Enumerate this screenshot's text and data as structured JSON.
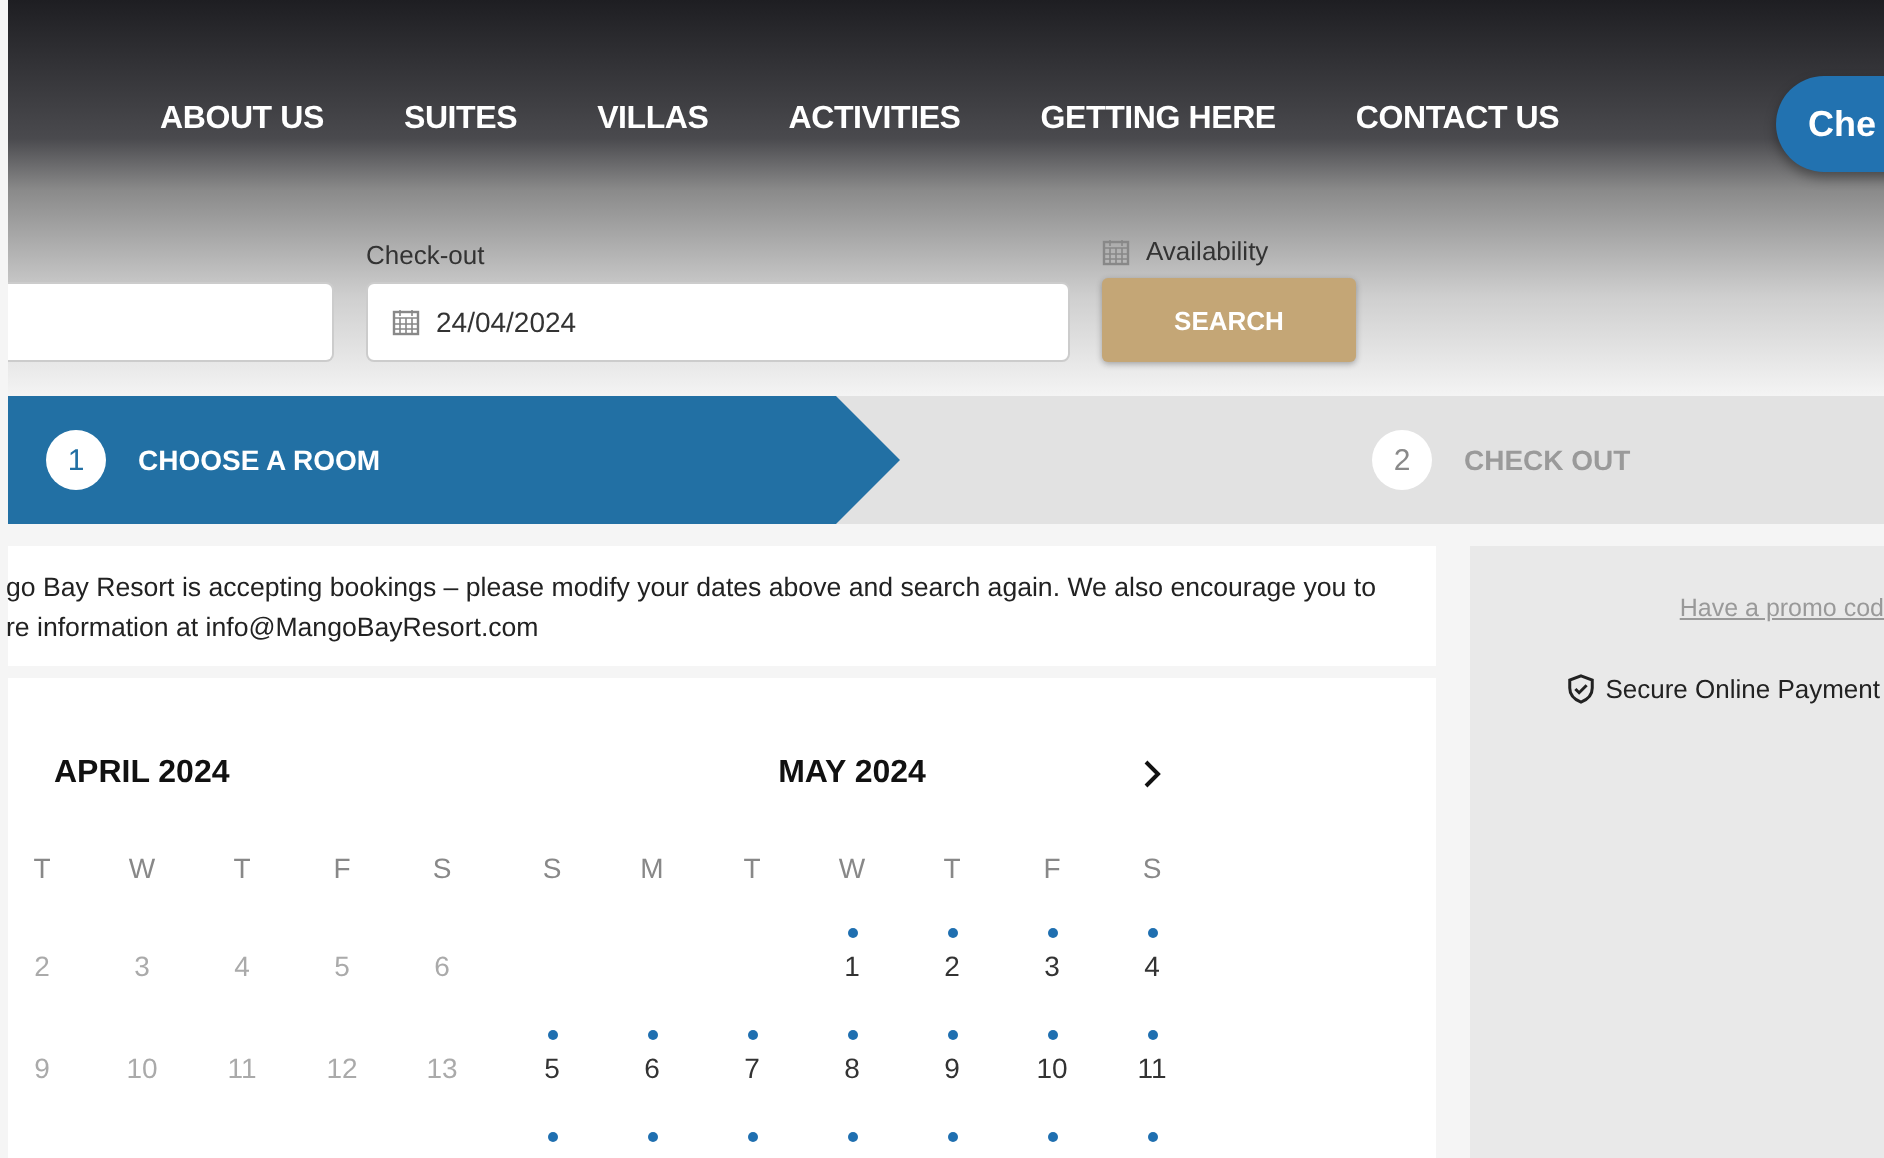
{
  "nav": {
    "items": [
      "ABOUT US",
      "SUITES",
      "VILLAS",
      "ACTIVITIES",
      "GETTING HERE",
      "CONTACT US"
    ],
    "cta": "Che"
  },
  "search": {
    "checkout_label": "Check-out",
    "checkout_value": "24/04/2024",
    "availability_label": "Availability",
    "button": "SEARCH"
  },
  "steps": [
    {
      "number": "1",
      "label": "CHOOSE A ROOM",
      "selected": true
    },
    {
      "number": "2",
      "label": "CHECK OUT",
      "selected": false
    }
  ],
  "notice": {
    "lines": [
      "go Bay Resort is accepting bookings – please modify your dates above and search again. We also encourage you to",
      "re information at info@MangoBayResort.com"
    ]
  },
  "calendar": {
    "months": [
      {
        "title": "APRIL 2024",
        "weekdays": [
          "T",
          "W",
          "T",
          "F",
          "S"
        ],
        "weeks": [
          [
            {
              "label": "2",
              "past": true
            },
            {
              "label": "3",
              "past": true
            },
            {
              "label": "4",
              "past": true
            },
            {
              "label": "5",
              "past": true
            },
            {
              "label": "6",
              "past": true
            }
          ],
          [
            {
              "label": "9",
              "past": true
            },
            {
              "label": "10",
              "past": true
            },
            {
              "label": "11",
              "past": true
            },
            {
              "label": "12",
              "past": true
            },
            {
              "label": "13",
              "past": true
            }
          ]
        ]
      },
      {
        "title": "MAY 2024",
        "next": true,
        "weekdays": [
          "S",
          "M",
          "T",
          "W",
          "T",
          "F",
          "S"
        ],
        "weeks": [
          [
            {
              "available": false
            },
            {
              "available": false
            },
            {
              "available": false
            },
            {
              "label": "1",
              "available": true
            },
            {
              "label": "2",
              "available": true
            },
            {
              "label": "3",
              "available": true
            },
            {
              "label": "4",
              "available": true
            }
          ],
          [
            {
              "label": "5",
              "available": true
            },
            {
              "label": "6",
              "available": true
            },
            {
              "label": "7",
              "available": true
            },
            {
              "label": "8",
              "available": true
            },
            {
              "label": "9",
              "available": true
            },
            {
              "label": "10",
              "available": true
            },
            {
              "label": "11",
              "available": true
            }
          ],
          [
            {
              "available": true
            },
            {
              "available": true
            },
            {
              "available": true
            },
            {
              "available": true
            },
            {
              "available": true
            },
            {
              "available": true
            },
            {
              "available": true
            }
          ]
        ]
      }
    ]
  },
  "sidebar": {
    "promo_link": "Have a promo cod",
    "secure": "Secure Online Payment"
  }
}
